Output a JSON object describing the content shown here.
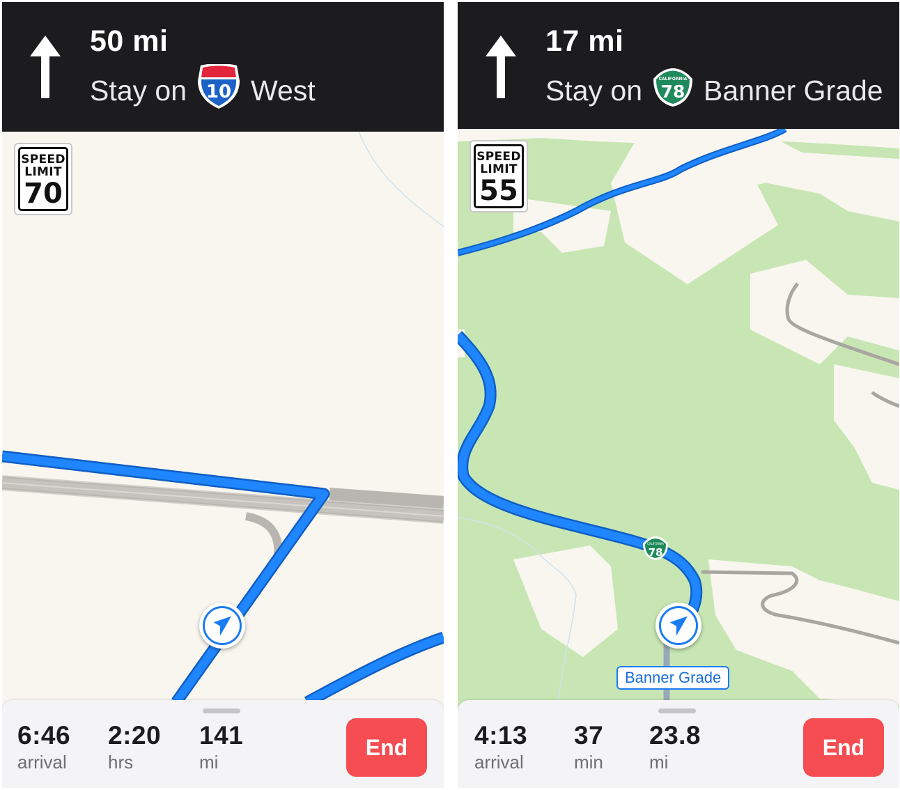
{
  "left": {
    "banner": {
      "distance": "50 mi",
      "stay_on_label": "Stay on",
      "route_shield": {
        "type": "interstate",
        "number": "10"
      },
      "road_name": "West",
      "maneuver_icon": "straight-arrow-icon"
    },
    "speed_limit": {
      "line1": "SPEED",
      "line2": "LIMIT",
      "value": "70"
    },
    "trip": {
      "arrival_time": "6:46",
      "arrival_label": "arrival",
      "duration_value": "2:20",
      "duration_label": "hrs",
      "distance_value": "141",
      "distance_label": "mi",
      "end_label": "End"
    }
  },
  "right": {
    "banner": {
      "distance": "17 mi",
      "stay_on_label": "Stay on",
      "route_shield": {
        "type": "california-state-route",
        "top_text": "CALIFORNIA",
        "number": "78"
      },
      "road_name": "Banner Grade",
      "maneuver_icon": "straight-arrow-icon"
    },
    "speed_limit": {
      "line1": "SPEED",
      "line2": "LIMIT",
      "value": "55"
    },
    "map_labels": {
      "road_label": "Banner Grade",
      "map_shield": {
        "top_text": "CALIFORNIA",
        "number": "78"
      }
    },
    "trip": {
      "arrival_time": "4:13",
      "arrival_label": "arrival",
      "duration_value": "37",
      "duration_label": "min",
      "distance_value": "23.8",
      "distance_label": "mi",
      "end_label": "End"
    }
  },
  "colors": {
    "banner_bg": "#1c1c1e",
    "route_blue": "#1a7cf2",
    "end_button": "#f54d52",
    "map_land": "#f9f6f0",
    "map_park": "#c8e6b4",
    "interstate_red": "#e2263b",
    "interstate_blue": "#1b62c6",
    "state_route_green": "#1f8a5c"
  }
}
